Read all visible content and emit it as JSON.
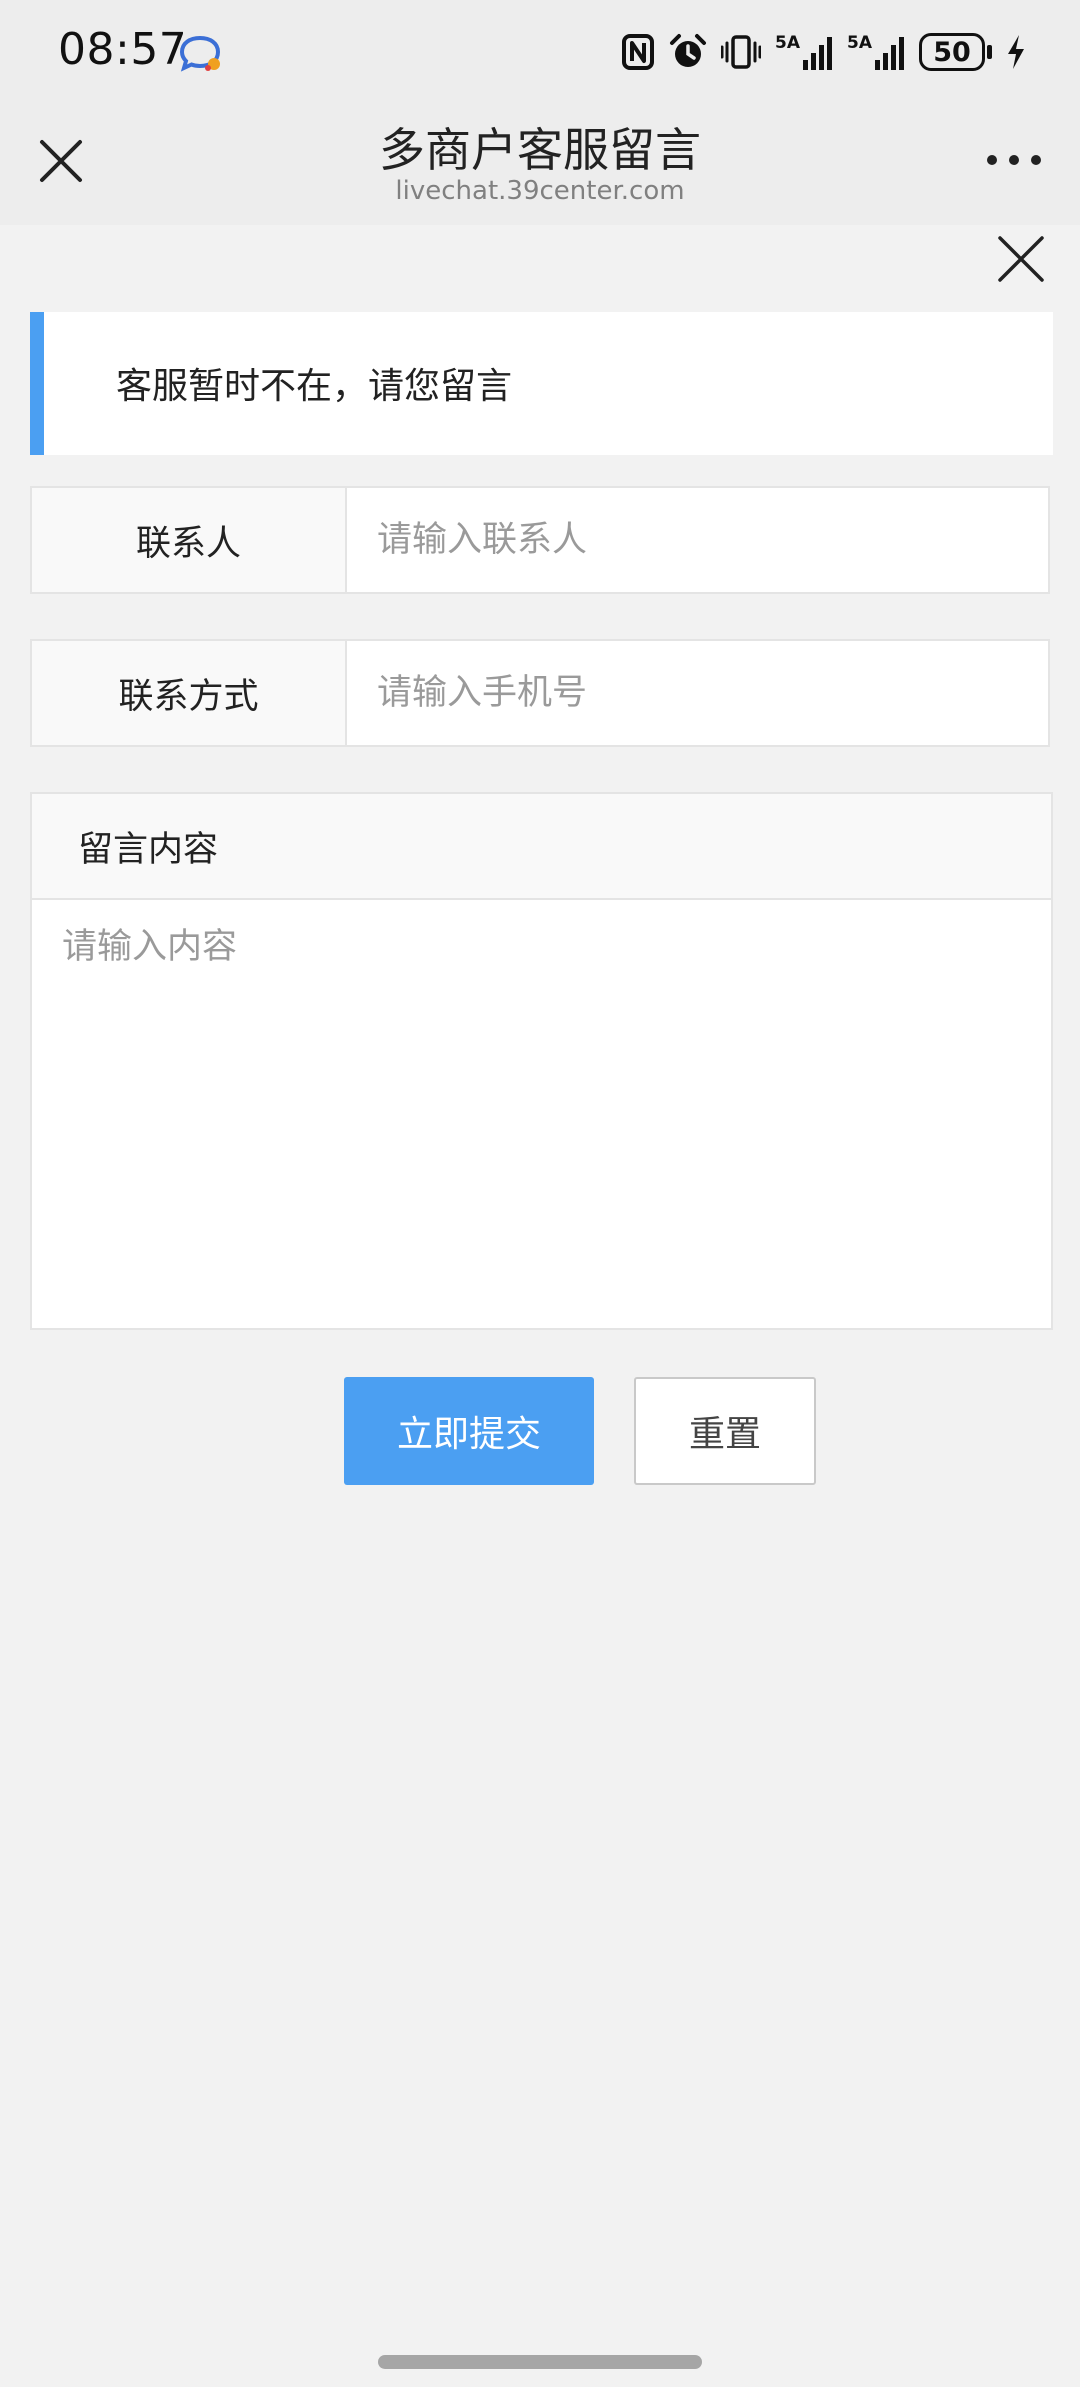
{
  "status_bar": {
    "time": "08:57",
    "battery_level": "50",
    "signal_1_label": "5A",
    "signal_2_label": "5A"
  },
  "nav": {
    "title": "多商户客服留言",
    "subtitle": "livechat.39center.com"
  },
  "notice": {
    "text": "客服暂时不在，请您留言"
  },
  "form": {
    "contact_name": {
      "label": "联系人",
      "placeholder": "请输入联系人",
      "value": ""
    },
    "contact_method": {
      "label": "联系方式",
      "placeholder": "请输入手机号",
      "value": ""
    },
    "message": {
      "label": "留言内容",
      "placeholder": "请输入内容",
      "value": ""
    }
  },
  "buttons": {
    "submit_label": "立即提交",
    "reset_label": "重置"
  },
  "colors": {
    "accent": "#4b9ff2",
    "background": "#f2f2f2",
    "header": "#ededed"
  },
  "icons": {
    "chat_notification": "chat-bubble-icon",
    "nfc": "nfc-icon",
    "alarm": "alarm-icon",
    "vibrate": "vibrate-icon",
    "close": "close-icon",
    "more": "more-icon",
    "charging": "charging-icon"
  }
}
